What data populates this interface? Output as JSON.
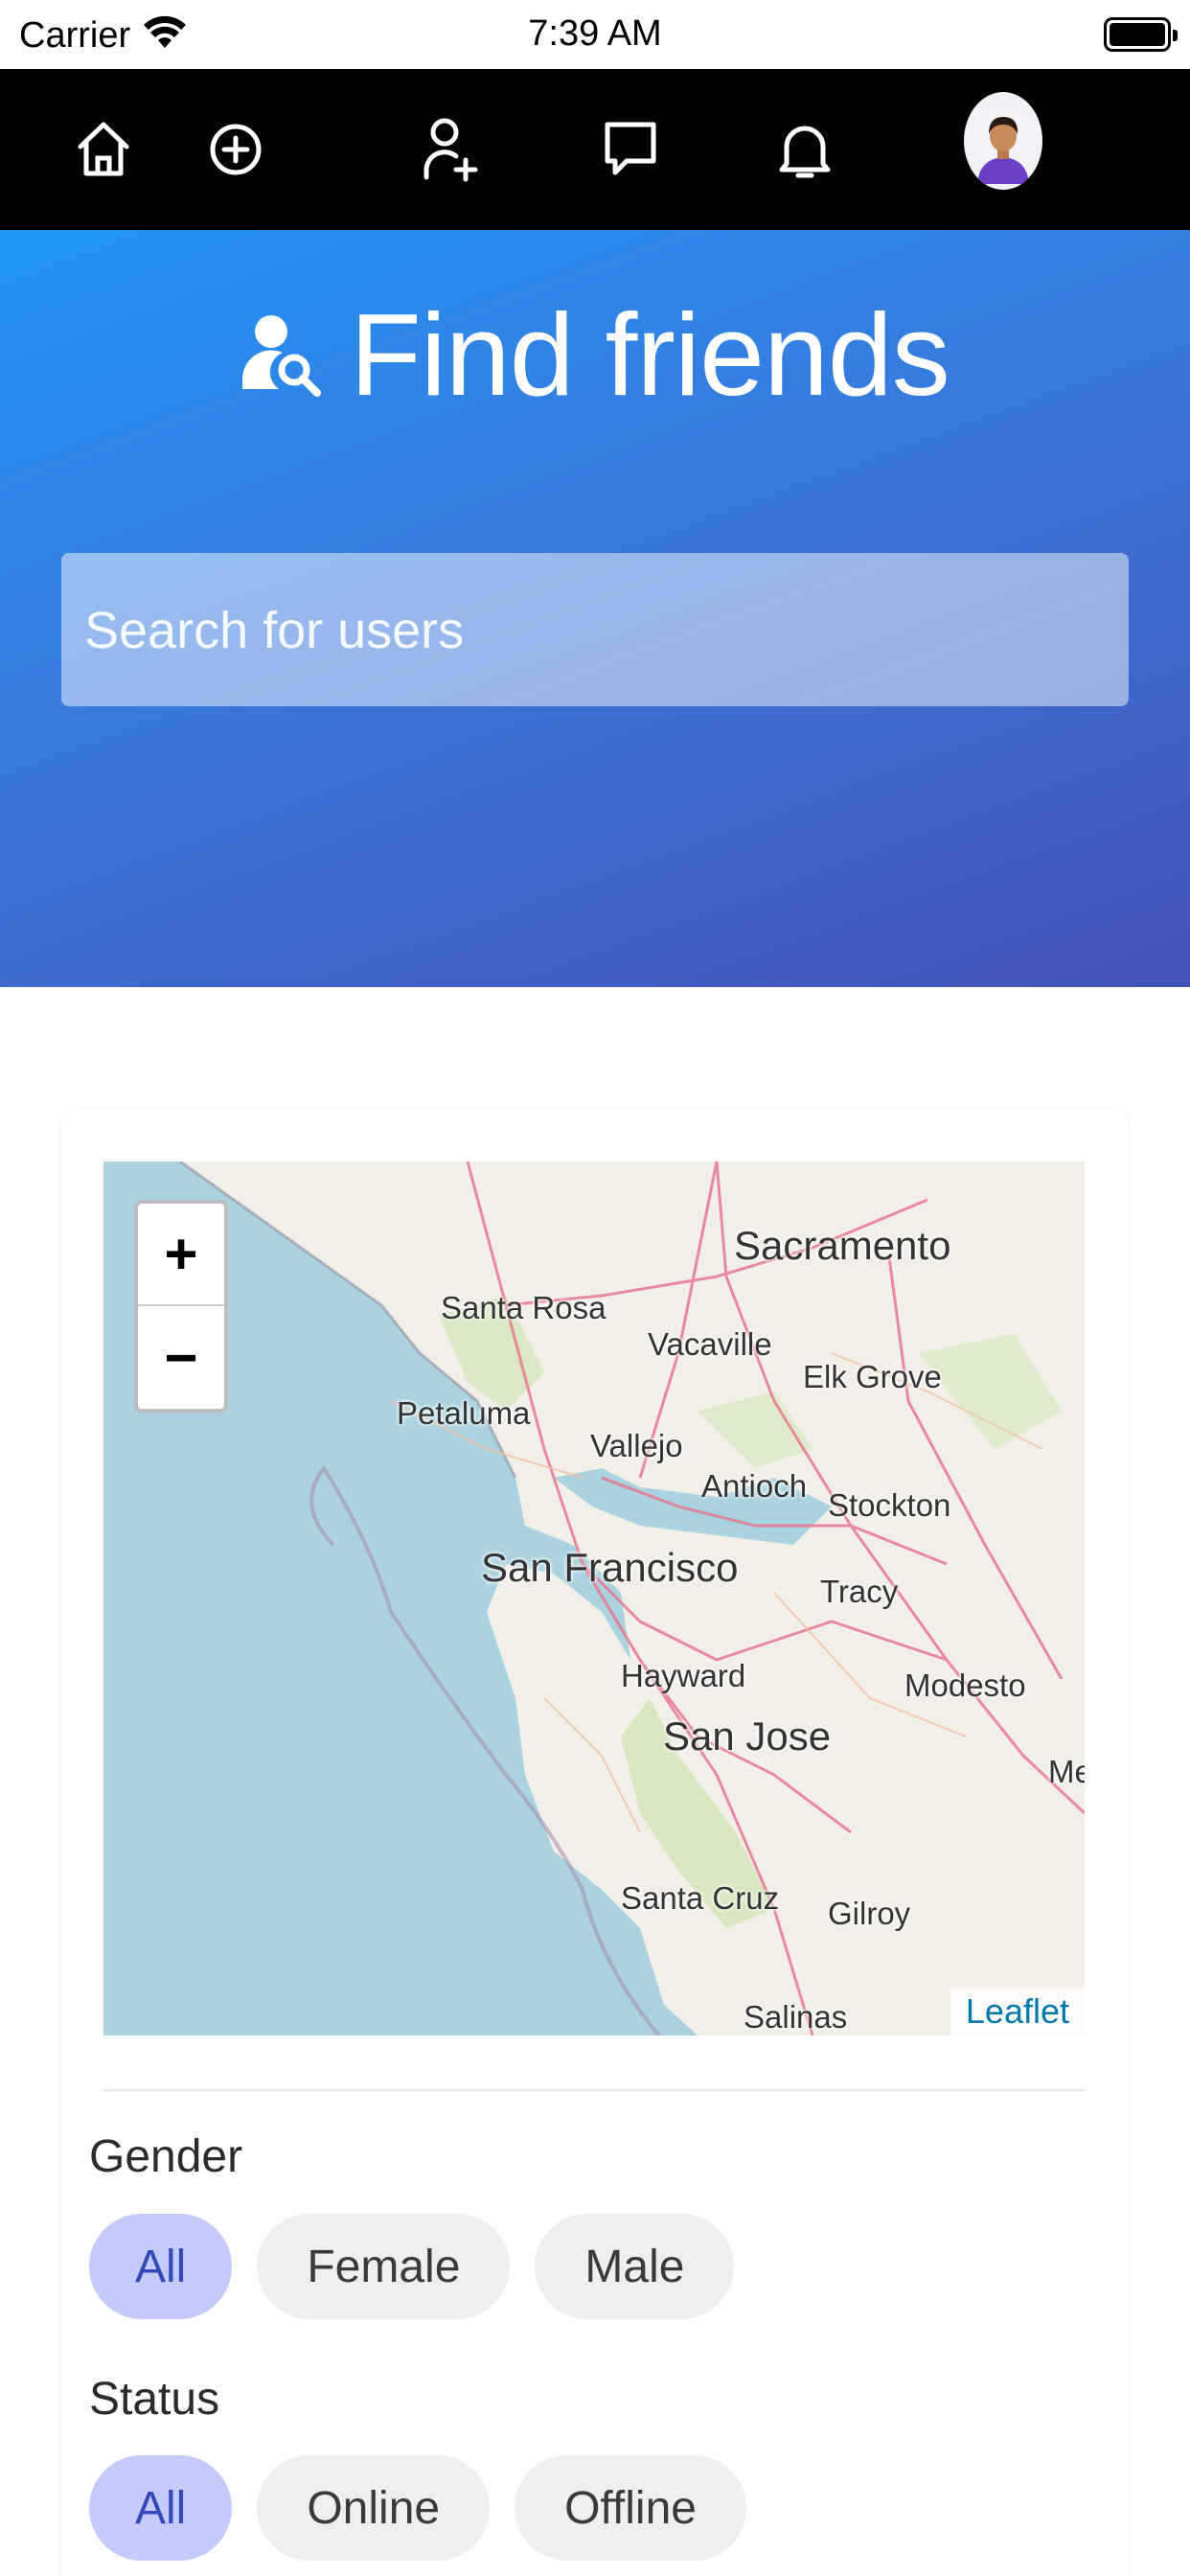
{
  "status_bar": {
    "carrier": "Carrier",
    "time": "7:39 AM"
  },
  "nav": {
    "icons": [
      "home-icon",
      "add-circle-icon",
      "add-user-icon",
      "message-icon",
      "bell-icon",
      "avatar"
    ]
  },
  "hero": {
    "title": "Find friends",
    "search_placeholder": "Search for users"
  },
  "map": {
    "zoom_in": "+",
    "zoom_out": "−",
    "attribution": "Leaflet",
    "cities": [
      "Sacramento",
      "Santa Rosa",
      "Vacaville",
      "Elk Grove",
      "Petaluma",
      "Vallejo",
      "Antioch",
      "Stockton",
      "San Francisco",
      "Tracy",
      "Hayward",
      "Modesto",
      "San Jose",
      "Me",
      "Santa Cruz",
      "Gilroy",
      "Salinas"
    ]
  },
  "filters": {
    "gender": {
      "label": "Gender",
      "options": [
        "All",
        "Female",
        "Male"
      ],
      "selected": "All"
    },
    "status": {
      "label": "Status",
      "options": [
        "All",
        "Online",
        "Offline"
      ],
      "selected": "All"
    }
  },
  "colors": {
    "chip_selected_bg": "#c5cbf8",
    "chip_selected_text": "#3349b8",
    "hero_start": "#2196f3",
    "hero_end": "#4452b6"
  }
}
